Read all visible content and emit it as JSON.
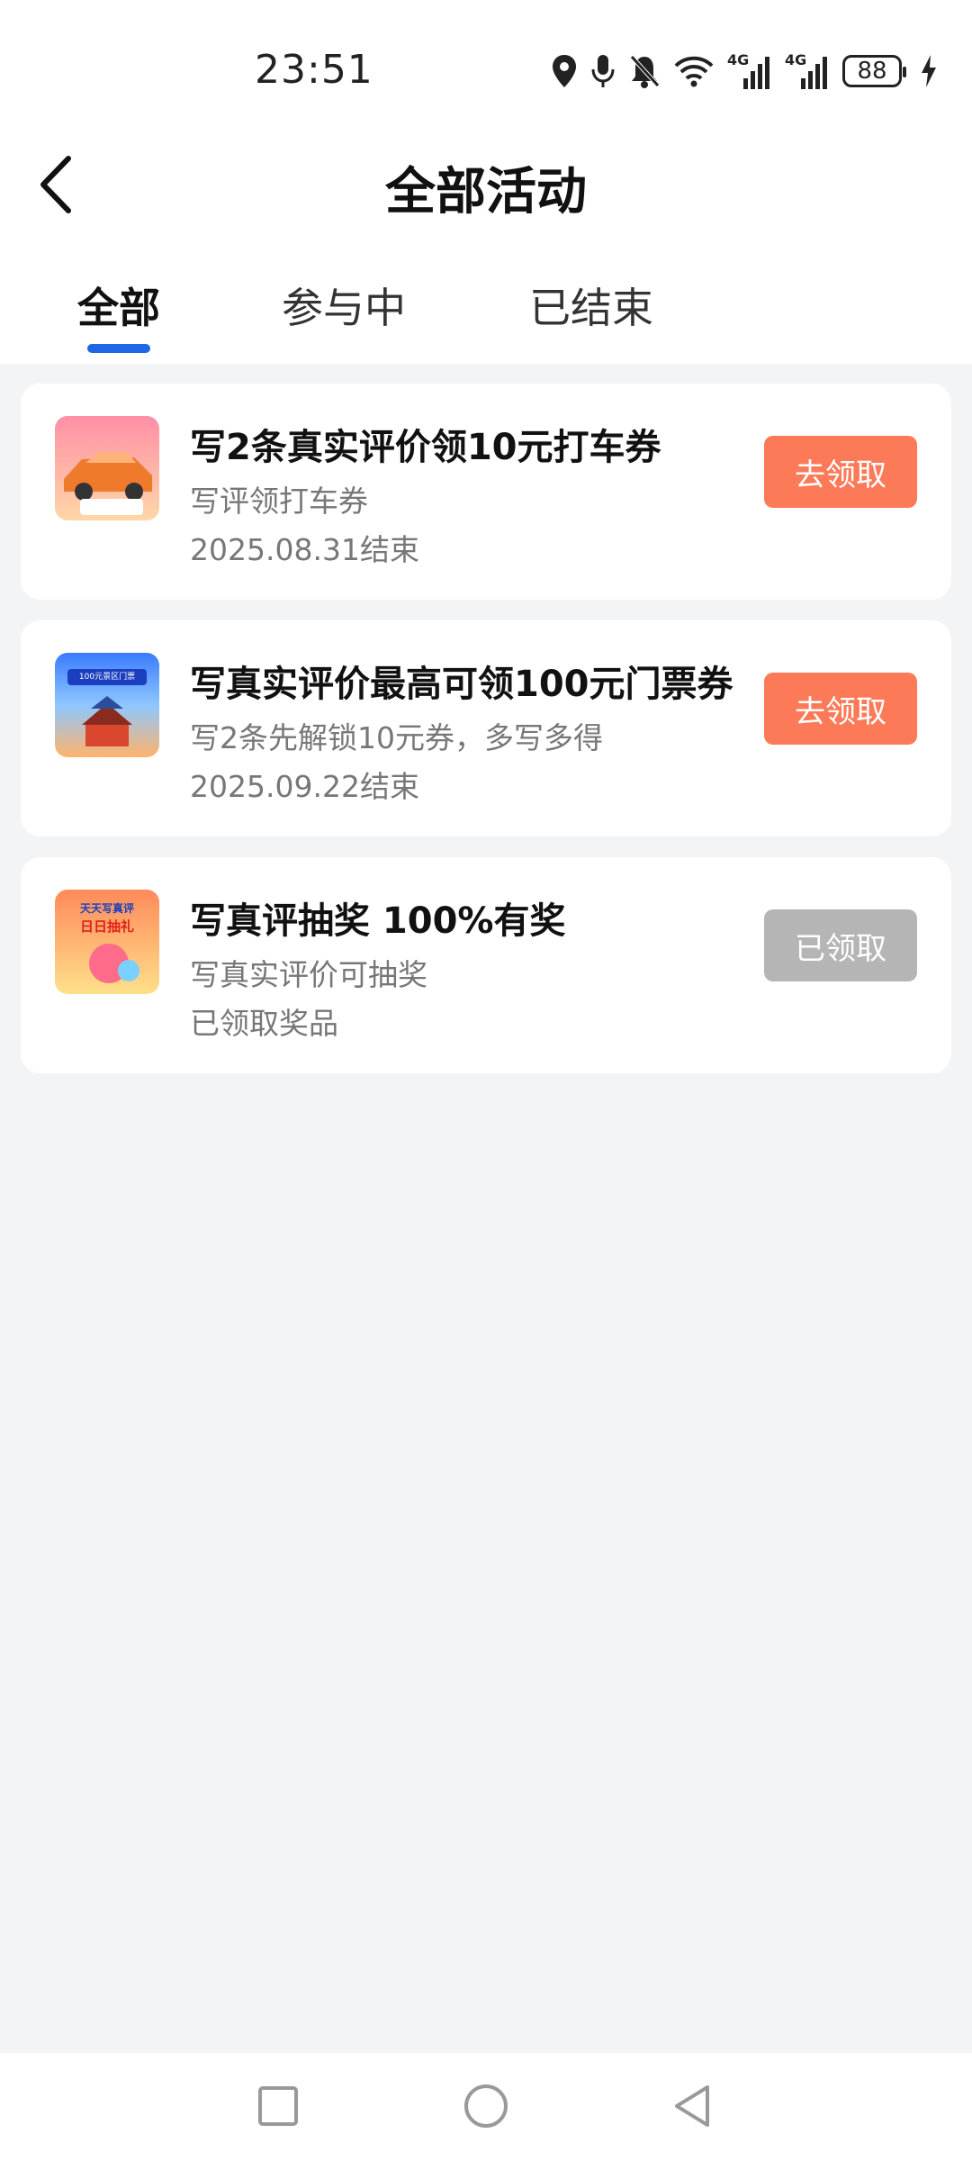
{
  "status_bar": {
    "time": "23:51",
    "signal1_tag": "4G",
    "signal2_tag": "4G",
    "battery": "88",
    "icons": [
      "location-icon",
      "mic-icon",
      "bell-muted-icon",
      "wifi-icon",
      "signal-icon",
      "signal-icon",
      "battery-icon",
      "charging-icon"
    ]
  },
  "header": {
    "title": "全部活动",
    "back_icon": "chevron-left-icon"
  },
  "tabs": [
    {
      "label": "全部",
      "active": true
    },
    {
      "label": "参与中",
      "active": false
    },
    {
      "label": "已结束",
      "active": false
    }
  ],
  "activities": [
    {
      "title": "写2条真实评价领10元打车券",
      "subtitle": "写评领打车券",
      "status": "2025.08.31结束",
      "button": "去领取",
      "button_color": "#fc7a57"
    },
    {
      "title": "写真实评价最高可领100元门票券",
      "subtitle": "写2条先解锁10元券，多写多得",
      "status": "2025.09.22结束",
      "button": "去领取",
      "button_color": "#fc7a57",
      "thumb_text": "100元景区门票"
    },
    {
      "title": "写真评抽奖 100%有奖",
      "subtitle": "写真实评价可抽奖",
      "status": "已领取奖品",
      "button": "已领取",
      "button_color": "#b5b5b5",
      "thumb_text_line1": "天天写真评",
      "thumb_text_line2": "日日抽礼"
    }
  ],
  "nav_bar": {
    "icons": [
      "square-recents-icon",
      "circle-home-icon",
      "triangle-back-icon"
    ]
  },
  "colors": {
    "accent": "#1e66e6",
    "background": "#f3f4f6"
  }
}
